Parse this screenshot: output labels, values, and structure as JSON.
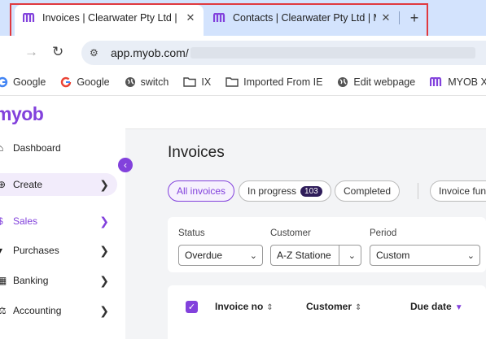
{
  "browser": {
    "tabs": [
      {
        "title": "Invoices | Clearwater Pty Ltd | M",
        "active": true,
        "favicon": "myob-logo-icon"
      },
      {
        "title": "Contacts | Clearwater Pty Ltd | M",
        "active": false,
        "favicon": "myob-logo-icon"
      }
    ],
    "new_tab_label": "+",
    "address": "app.myob.com/",
    "bookmarks": [
      {
        "label": "Google",
        "icon": "google-icon"
      },
      {
        "label": "Google",
        "icon": "google-icon"
      },
      {
        "label": "switch",
        "icon": "globe-icon"
      },
      {
        "label": "IX",
        "icon": "folder-icon"
      },
      {
        "label": "Imported From IE",
        "icon": "folder-icon"
      },
      {
        "label": "Edit webpage",
        "icon": "globe-icon"
      },
      {
        "label": "MYOB X He",
        "icon": "myob-logo-icon"
      }
    ]
  },
  "app": {
    "logo": "myob",
    "brand_color": "#8241dc",
    "sidebar": [
      {
        "label": "Dashboard",
        "icon": "home-icon",
        "chevron": false
      },
      {
        "label": "Create",
        "icon": "plus-circle-icon",
        "chevron": true
      },
      {
        "label": "Sales",
        "icon": "dollar-circle-icon",
        "chevron": true
      },
      {
        "label": "Purchases",
        "icon": "cart-icon",
        "chevron": true
      },
      {
        "label": "Banking",
        "icon": "bank-icon",
        "chevron": true
      },
      {
        "label": "Accounting",
        "icon": "scales-icon",
        "chevron": true
      }
    ],
    "page_title": "Invoices",
    "status_tabs": [
      {
        "label": "All invoices"
      },
      {
        "label": "In progress",
        "count": "103"
      },
      {
        "label": "Completed"
      },
      {
        "label": "Invoice fun"
      }
    ],
    "filters": {
      "status": {
        "label": "Status",
        "value": "Overdue"
      },
      "customer": {
        "label": "Customer",
        "value": "A-Z Statione"
      },
      "period": {
        "label": "Period",
        "value": "Custom"
      }
    },
    "table_headers": {
      "invoice_no": "Invoice no",
      "customer": "Customer",
      "due_date": "Due date"
    }
  }
}
